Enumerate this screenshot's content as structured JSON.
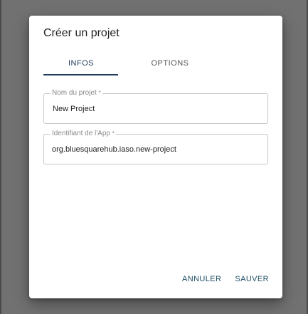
{
  "dialog": {
    "title": "Créer un projet",
    "tabs": [
      {
        "label": "INFOS",
        "active": true
      },
      {
        "label": "OPTIONS",
        "active": false
      }
    ],
    "fields": {
      "project_name": {
        "label": "Nom du projet",
        "required_mark": "*",
        "value": "New Project"
      },
      "app_id": {
        "label": "Identifiant de l'App",
        "required_mark": "*",
        "value": "org.bluesquarehub.iaso.new-project"
      }
    },
    "actions": {
      "cancel_label": "ANNULER",
      "save_label": "SAUVER"
    }
  },
  "colors": {
    "accent": "#1e3a5a",
    "backdrop": "#717171",
    "button_text": "#1e4f66"
  }
}
